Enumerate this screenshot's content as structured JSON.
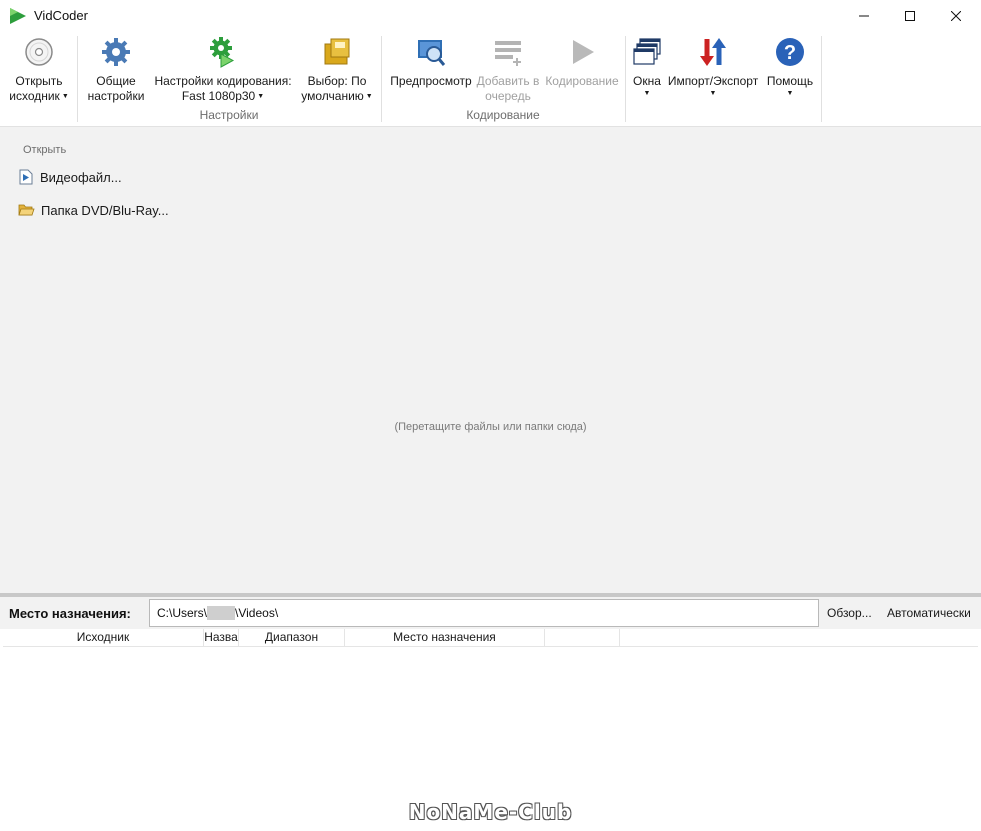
{
  "window": {
    "title": "VidCoder",
    "controls": [
      "minimize-icon",
      "maximize-icon",
      "close-icon"
    ]
  },
  "ribbon": {
    "open_source": {
      "line1": "Открыть",
      "line2": "исходник"
    },
    "general_settings": {
      "line1": "Общие",
      "line2": "настройки"
    },
    "encoding_settings": {
      "line1": "Настройки кодирования:",
      "line2": "Fast 1080p30"
    },
    "pick": {
      "line1": "Выбор: По",
      "line2": "умолчанию"
    },
    "preview": {
      "line1": "Предпросмотр"
    },
    "add_to_queue": {
      "line1": "Добавить в",
      "line2": "очередь"
    },
    "encode": {
      "line1": "Кодирование"
    },
    "windows": {
      "line1": "Окна"
    },
    "import_export": {
      "line1": "Импорт/Экспорт"
    },
    "help": {
      "line1": "Помощь"
    },
    "groups": {
      "settings": "Настройки",
      "encoding": "Кодирование"
    }
  },
  "main": {
    "open_header": "Открыть",
    "video_file": "Видеофайл...",
    "dvd_folder": "Папка DVD/Blu-Ray...",
    "drop_hint": "(Перетащите файлы или папки сюда)"
  },
  "destination": {
    "label": "Место назначения:",
    "path_prefix": "C:\\Users\\",
    "path_suffix": "\\Videos\\",
    "browse": "Обзор...",
    "auto": "Автоматически"
  },
  "queue": {
    "columns": [
      "Исходник",
      "Назва",
      "Диапазон",
      "Место назначения",
      ""
    ]
  },
  "watermark": "NoNaMe-Club",
  "colors": {
    "accent_blue": "#2f6fb5",
    "play_green": "#2d9e3c",
    "gear_blue": "#4a7ab5",
    "folder_yellow": "#d9a81c",
    "import_red": "#cc2222",
    "help_blue": "#2a62b8"
  }
}
